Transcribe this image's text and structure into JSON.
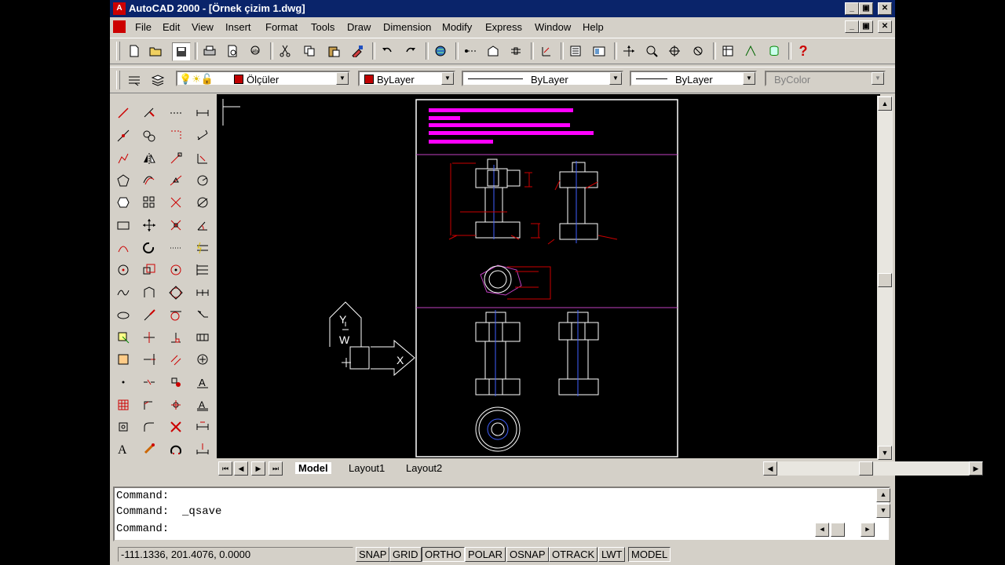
{
  "title": "AutoCAD 2000 - [Örnek çizim 1.dwg]",
  "menu": [
    "File",
    "Edit",
    "View",
    "Insert",
    "Format",
    "Tools",
    "Draw",
    "Dimension",
    "Modify",
    "Express",
    "Window",
    "Help"
  ],
  "properties_toolbar": {
    "layer": "Ölçüler",
    "color": "ByLayer",
    "linetype": "ByLayer",
    "lineweight": "ByLayer",
    "plotstyle": "ByColor"
  },
  "ucs": {
    "x_label": "X",
    "y_label": "Y",
    "w_label": "W"
  },
  "tabs": [
    "Model",
    "Layout1",
    "Layout2"
  ],
  "command_lines": [
    "Command:",
    "Command:  _qsave",
    "Command:"
  ],
  "coordinates": "-111.1336, 201.4076, 0.0000",
  "status_buttons": [
    "SNAP",
    "GRID",
    "ORTHO",
    "POLAR",
    "OSNAP",
    "OTRACK",
    "LWT",
    "MODEL"
  ],
  "colors": {
    "title_bg": "#0a246a",
    "canvas": "#000000",
    "layer_color": "#c00000",
    "dim_color": "#ff00ff"
  }
}
